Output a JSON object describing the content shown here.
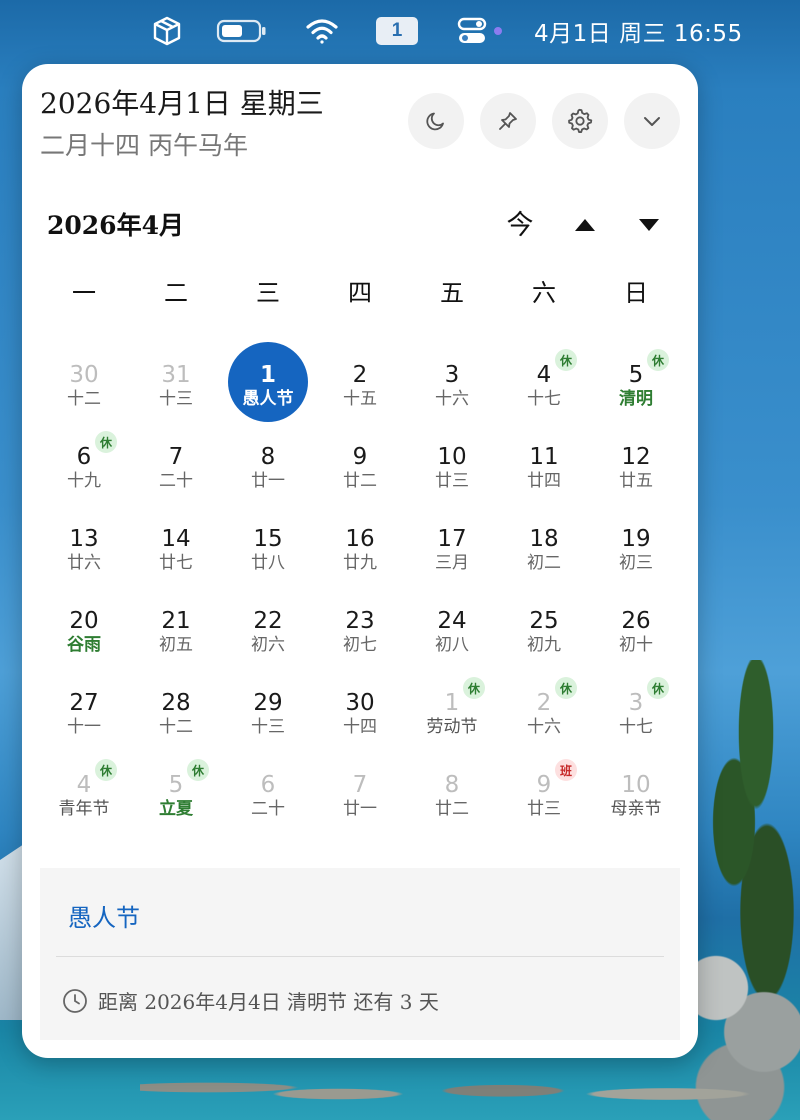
{
  "menubar": {
    "icons": [
      "cube-icon",
      "battery-icon",
      "wifi-icon",
      "calendar-icon",
      "control-center-icon"
    ],
    "calendar_day": "1",
    "clock": "4月1日 周三  16:55"
  },
  "header": {
    "date": "2026年4月1日 星期三",
    "lunar": "二月十四 丙午马年",
    "buttons": [
      "moon-icon",
      "pin-icon",
      "gear-icon",
      "chevron-down-icon"
    ]
  },
  "nav": {
    "month_title": "2026年4月",
    "today_label": "今"
  },
  "weekdays": [
    "一",
    "二",
    "三",
    "四",
    "五",
    "六",
    "日"
  ],
  "colors": {
    "accent": "#1565c0",
    "term": "#2e7d32",
    "rest_badge_bg": "#daf2dc",
    "work_badge_bg": "#fde0e0"
  },
  "days": [
    {
      "num": "30",
      "sub": "十二",
      "other": true
    },
    {
      "num": "31",
      "sub": "十三",
      "other": true
    },
    {
      "num": "1",
      "sub": "愚人节",
      "today": true
    },
    {
      "num": "2",
      "sub": "十五"
    },
    {
      "num": "3",
      "sub": "十六"
    },
    {
      "num": "4",
      "sub": "十七",
      "badge": "休"
    },
    {
      "num": "5",
      "sub": "清明",
      "badge": "休",
      "term": true
    },
    {
      "num": "6",
      "sub": "十九",
      "badge": "休"
    },
    {
      "num": "7",
      "sub": "二十"
    },
    {
      "num": "8",
      "sub": "廿一"
    },
    {
      "num": "9",
      "sub": "廿二"
    },
    {
      "num": "10",
      "sub": "廿三"
    },
    {
      "num": "11",
      "sub": "廿四"
    },
    {
      "num": "12",
      "sub": "廿五"
    },
    {
      "num": "13",
      "sub": "廿六"
    },
    {
      "num": "14",
      "sub": "廿七"
    },
    {
      "num": "15",
      "sub": "廿八"
    },
    {
      "num": "16",
      "sub": "廿九"
    },
    {
      "num": "17",
      "sub": "三月"
    },
    {
      "num": "18",
      "sub": "初二"
    },
    {
      "num": "19",
      "sub": "初三"
    },
    {
      "num": "20",
      "sub": "谷雨",
      "term": true
    },
    {
      "num": "21",
      "sub": "初五"
    },
    {
      "num": "22",
      "sub": "初六"
    },
    {
      "num": "23",
      "sub": "初七"
    },
    {
      "num": "24",
      "sub": "初八"
    },
    {
      "num": "25",
      "sub": "初九"
    },
    {
      "num": "26",
      "sub": "初十"
    },
    {
      "num": "27",
      "sub": "十一"
    },
    {
      "num": "28",
      "sub": "十二"
    },
    {
      "num": "29",
      "sub": "十三"
    },
    {
      "num": "30",
      "sub": "十四"
    },
    {
      "num": "1",
      "sub": "劳动节",
      "other": true,
      "badge": "休",
      "fest": true
    },
    {
      "num": "2",
      "sub": "十六",
      "other": true,
      "badge": "休"
    },
    {
      "num": "3",
      "sub": "十七",
      "other": true,
      "badge": "休"
    },
    {
      "num": "4",
      "sub": "青年节",
      "other": true,
      "badge": "休",
      "fest": true
    },
    {
      "num": "5",
      "sub": "立夏",
      "other": true,
      "badge": "休",
      "term": true
    },
    {
      "num": "6",
      "sub": "二十",
      "other": true
    },
    {
      "num": "7",
      "sub": "廿一",
      "other": true
    },
    {
      "num": "8",
      "sub": "廿二",
      "other": true
    },
    {
      "num": "9",
      "sub": "廿三",
      "other": true,
      "badge": "班",
      "work": true
    },
    {
      "num": "10",
      "sub": "母亲节",
      "other": true,
      "fest": true
    }
  ],
  "info": {
    "title": "愚人节",
    "countdown": "距离 2026年4月4日 清明节 还有 3 天"
  }
}
